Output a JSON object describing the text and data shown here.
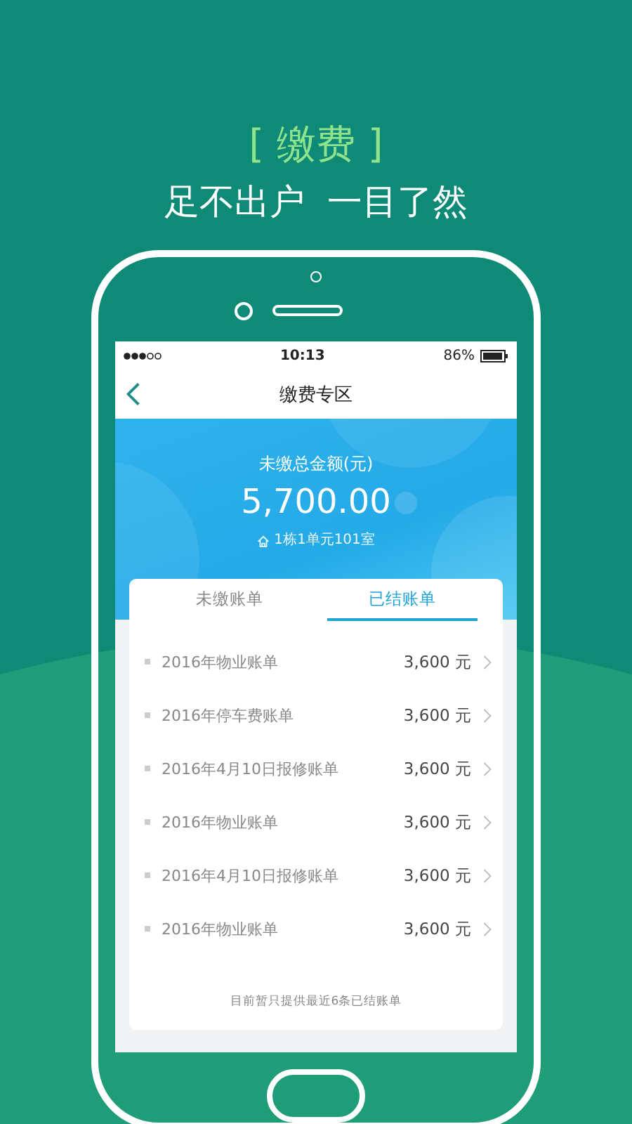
{
  "headline": "[ 缴费 ]",
  "subtitle": "足不出户  一目了然",
  "status_bar": {
    "time": "10:13",
    "battery": "86%"
  },
  "nav": {
    "title": "缴费专区"
  },
  "summary": {
    "label": "未缴总金额(元)",
    "amount": "5,700.00",
    "address": "1栋1单元101室"
  },
  "tabs": [
    {
      "label": "未缴账单",
      "selected": false
    },
    {
      "label": "已结账单",
      "selected": true
    }
  ],
  "bills": [
    {
      "name": "2016年物业账单",
      "amount": "3,600 元"
    },
    {
      "name": "2016年停车费账单",
      "amount": "3,600 元"
    },
    {
      "name": "2016年4月10日报修账单",
      "amount": "3,600 元"
    },
    {
      "name": "2016年物业账单",
      "amount": "3,600 元"
    },
    {
      "name": "2016年4月10日报修账单",
      "amount": "3,600 元"
    },
    {
      "name": "2016年物业账单",
      "amount": "3,600 元"
    }
  ],
  "footnote": "目前暂只提供最近6条已结账单"
}
